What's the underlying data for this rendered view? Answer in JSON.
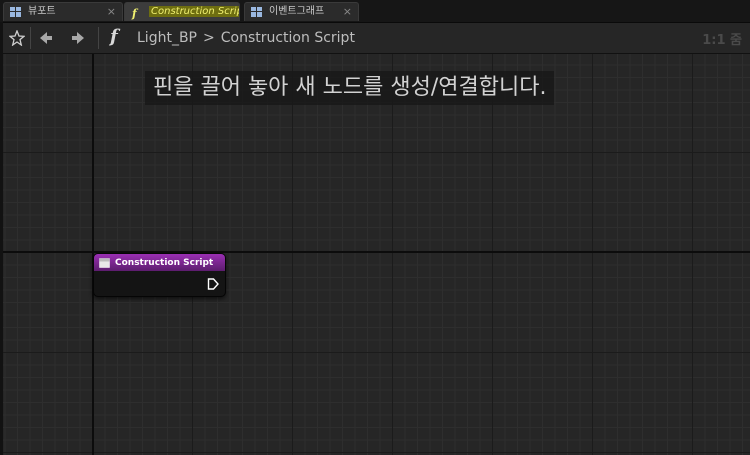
{
  "tabs": [
    {
      "label": "뷰포트",
      "icon": "viewport-grid-icon",
      "close": "×"
    },
    {
      "label": "Construction Scrip",
      "icon": "function-icon",
      "close": "×"
    },
    {
      "label": "이벤트그래프",
      "icon": "event-graph-grid-icon",
      "close": "×"
    }
  ],
  "toolbar": {
    "function_glyph": "f",
    "breadcrumb": {
      "root": "Light_BP",
      "separator": ">",
      "current": "Construction Script"
    },
    "zoom_label": "1:1 줌"
  },
  "graph": {
    "hint_text": "핀을 끌어 놓아 새 노드를 생성/연결합니다.",
    "node": {
      "title": "Construction Script",
      "header_color": "#8a2aa3"
    }
  }
}
